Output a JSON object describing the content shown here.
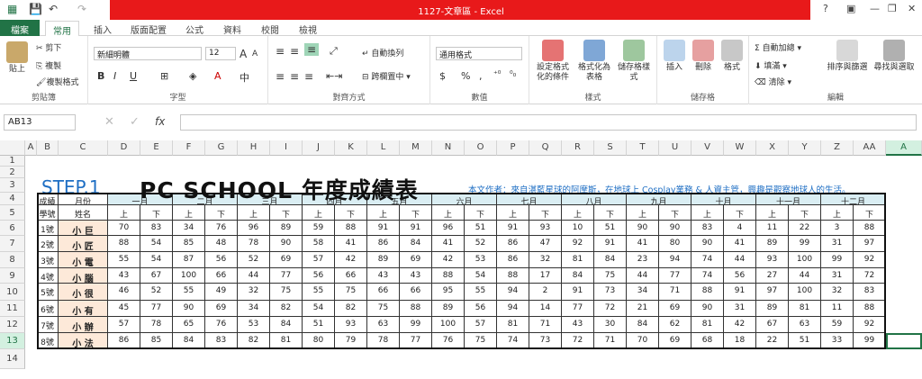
{
  "window": {
    "title": "1127-文章區 - Excel"
  },
  "tabs": [
    "檔案",
    "常用",
    "插入",
    "版面配置",
    "公式",
    "資料",
    "校閱",
    "檢視"
  ],
  "ribbon": {
    "clipboard": {
      "paste": "貼上",
      "cut": "剪下",
      "copy": "複製",
      "format_painter": "複製格式",
      "label": "剪貼簿"
    },
    "font": {
      "name": "新細明體",
      "size": "12",
      "bold": "B",
      "italic": "I",
      "underline": "U",
      "label": "字型"
    },
    "alignment": {
      "wrap": "自動換列",
      "merge": "跨欄置中",
      "label": "對齊方式"
    },
    "number": {
      "format": "通用格式",
      "currency": "$",
      "percent": "%",
      "comma": ",",
      "label": "數值"
    },
    "styles": {
      "conditional": "設定格式化的條件",
      "as_table": "格式化為表格",
      "cell_styles": "儲存格樣式",
      "label": "樣式"
    },
    "cells": {
      "insert": "插入",
      "delete": "刪除",
      "format": "格式",
      "label": "儲存格"
    },
    "editing": {
      "autosum": "自動加總",
      "fill": "填滿",
      "clear": "清除",
      "sort": "排序與篩選",
      "find": "尋找與選取",
      "label": "編輯"
    }
  },
  "formula_bar": {
    "name_box": "AB13",
    "fx": "fx",
    "value": ""
  },
  "columns": [
    "A",
    "B",
    "C",
    "D",
    "E",
    "F",
    "G",
    "H",
    "I",
    "J",
    "K",
    "L",
    "M",
    "N",
    "O",
    "P",
    "Q",
    "R",
    "S",
    "T",
    "U",
    "V",
    "W",
    "X",
    "Y",
    "Z",
    "AA",
    "A"
  ],
  "rows": [
    "1",
    "2",
    "3",
    "4",
    "5",
    "6",
    "7",
    "8",
    "9",
    "10",
    "11",
    "12",
    "13",
    "14"
  ],
  "sheet": {
    "step": "STEP.1",
    "title": "PC SCHOOL 年度成績表",
    "author": "本文作者：來自湛藍星球的阿摩斯，在地球上 Cosplay業務 & 人資主管，興趣是觀察地球人的生活。",
    "hdr_grade": "成績",
    "hdr_month": "月份",
    "hdr_id": "學號",
    "hdr_name": "姓名",
    "months": [
      "一月",
      "二月",
      "三月",
      "四月",
      "五月",
      "六月",
      "七月",
      "八月",
      "九月",
      "十月",
      "十一月",
      "十二月"
    ],
    "half_up": "上",
    "half_down": "下",
    "students": [
      {
        "id": "1號",
        "name": "小 巨",
        "scores": [
          "70",
          "83",
          "34",
          "76",
          "96",
          "89",
          "59",
          "88",
          "91",
          "91",
          "96",
          "51",
          "91",
          "93",
          "10",
          "51",
          "90",
          "90",
          "83",
          "4",
          "11",
          "22",
          "3",
          "88"
        ]
      },
      {
        "id": "2號",
        "name": "小 匠",
        "scores": [
          "88",
          "54",
          "85",
          "48",
          "78",
          "90",
          "58",
          "41",
          "86",
          "84",
          "41",
          "52",
          "86",
          "47",
          "92",
          "91",
          "41",
          "80",
          "90",
          "41",
          "89",
          "99",
          "31",
          "97"
        ]
      },
      {
        "id": "3號",
        "name": "小 電",
        "scores": [
          "55",
          "54",
          "87",
          "56",
          "52",
          "69",
          "57",
          "42",
          "89",
          "69",
          "42",
          "53",
          "86",
          "32",
          "81",
          "84",
          "23",
          "94",
          "74",
          "44",
          "93",
          "100",
          "99",
          "92"
        ]
      },
      {
        "id": "4號",
        "name": "小 腦",
        "scores": [
          "43",
          "67",
          "100",
          "66",
          "44",
          "77",
          "56",
          "66",
          "43",
          "43",
          "88",
          "54",
          "88",
          "17",
          "84",
          "75",
          "44",
          "77",
          "74",
          "56",
          "27",
          "44",
          "31",
          "72"
        ]
      },
      {
        "id": "5號",
        "name": "小 很",
        "scores": [
          "46",
          "52",
          "55",
          "49",
          "32",
          "75",
          "55",
          "75",
          "66",
          "66",
          "95",
          "55",
          "94",
          "2",
          "91",
          "73",
          "34",
          "71",
          "88",
          "91",
          "97",
          "100",
          "32",
          "83"
        ]
      },
      {
        "id": "6號",
        "name": "小 有",
        "scores": [
          "45",
          "77",
          "90",
          "69",
          "34",
          "82",
          "54",
          "82",
          "75",
          "88",
          "89",
          "56",
          "94",
          "14",
          "77",
          "72",
          "21",
          "69",
          "90",
          "31",
          "89",
          "81",
          "11",
          "88"
        ]
      },
      {
        "id": "7號",
        "name": "小 辦",
        "scores": [
          "57",
          "78",
          "65",
          "76",
          "53",
          "84",
          "51",
          "93",
          "63",
          "99",
          "100",
          "57",
          "81",
          "71",
          "43",
          "30",
          "84",
          "62",
          "81",
          "42",
          "67",
          "63",
          "59",
          "92"
        ]
      },
      {
        "id": "8號",
        "name": "小 法",
        "scores": [
          "86",
          "85",
          "84",
          "83",
          "82",
          "81",
          "80",
          "79",
          "78",
          "77",
          "76",
          "75",
          "74",
          "73",
          "72",
          "71",
          "70",
          "69",
          "68",
          "18",
          "22",
          "51",
          "33",
          "99"
        ]
      }
    ]
  },
  "colors": {
    "excel_green": "#217346",
    "title_red": "#e8191a",
    "header_blue": "#daeef3",
    "name_peach": "#fde9d9",
    "step_blue": "#1f6fc4"
  }
}
